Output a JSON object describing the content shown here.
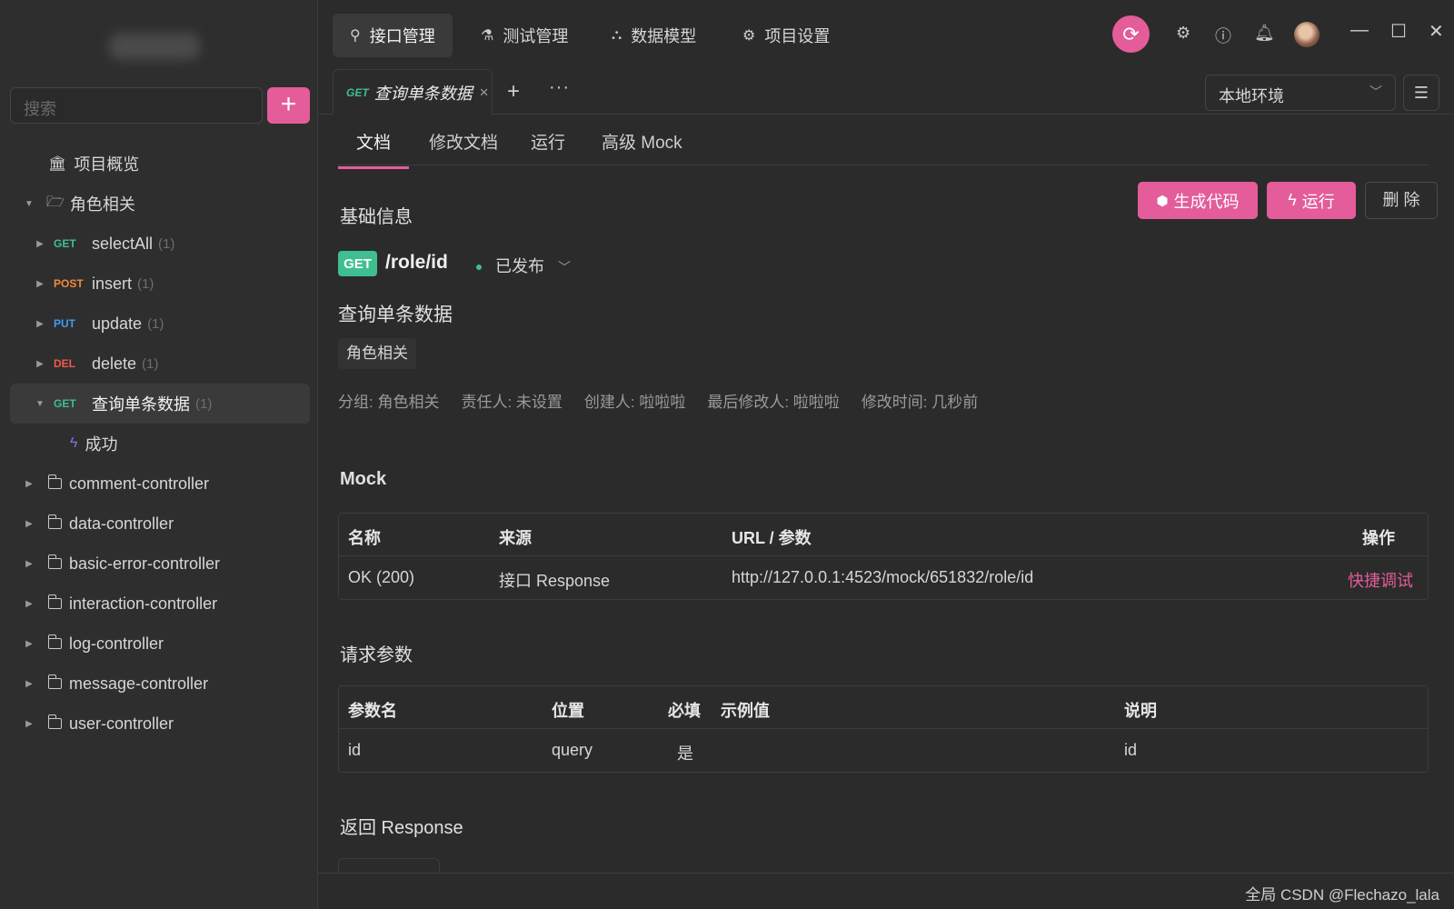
{
  "sidebar": {
    "search_placeholder": "搜索",
    "add_label": "+",
    "overview_label": "项目概览",
    "group_label": "角色相关",
    "endpoints": [
      {
        "method": "GET",
        "name": "selectAll",
        "count": "(1)"
      },
      {
        "method": "POST",
        "name": "insert",
        "count": "(1)"
      },
      {
        "method": "PUT",
        "name": "update",
        "count": "(1)"
      },
      {
        "method": "DEL",
        "name": "delete",
        "count": "(1)"
      },
      {
        "method": "GET",
        "name": "查询单条数据",
        "count": "(1)"
      }
    ],
    "success_case": "成功",
    "folders": [
      "comment-controller",
      "data-controller",
      "basic-error-controller",
      "interaction-controller",
      "log-controller",
      "message-controller",
      "user-controller"
    ]
  },
  "topbar": {
    "tabs": [
      "接口管理",
      "测试管理",
      "数据模型",
      "项目设置"
    ]
  },
  "doc_tabs": {
    "active_method": "GET",
    "active_title": "查询单条数据",
    "close": "×",
    "plus": "+",
    "more": "···",
    "env": "本地环境"
  },
  "subtabs": [
    "文档",
    "修改文档",
    "运行",
    "高级 Mock"
  ],
  "doc": {
    "basic_info_title": "基础信息",
    "btn_generate": "生成代码",
    "btn_run": "运行",
    "btn_delete": "删 除",
    "method": "GET",
    "path": "/role/id",
    "status": "已发布",
    "api_name": "查询单条数据",
    "tag": "角色相关",
    "meta": {
      "group": "分组: 角色相关",
      "owner": "责任人: 未设置",
      "creator": "创建人:  啦啦啦",
      "modifier": "最后修改人:  啦啦啦",
      "modified": "修改时间: 几秒前"
    },
    "mock_title": "Mock",
    "mock_table": {
      "headers": [
        "名称",
        "来源",
        "URL / 参数",
        "操作"
      ],
      "rows": [
        [
          "OK (200)",
          "接口 Response",
          "http://127.0.0.1:4523/mock/651832/role/id",
          "快捷调试"
        ]
      ]
    },
    "params_title": "请求参数",
    "params_table": {
      "headers": [
        "参数名",
        "位置",
        "必填",
        "示例值",
        "说明"
      ],
      "rows": [
        [
          "id",
          "query",
          "是",
          "",
          "id"
        ]
      ]
    },
    "response_title": "返回 Response"
  },
  "footer": {
    "watermark": "全局 CSDN @Flechazo_lala"
  },
  "colors": {
    "accent": "#e45c9a",
    "get": "#3fbf8f",
    "post": "#f08a3c",
    "put": "#3f9cf0",
    "delete": "#ef5b4c"
  }
}
